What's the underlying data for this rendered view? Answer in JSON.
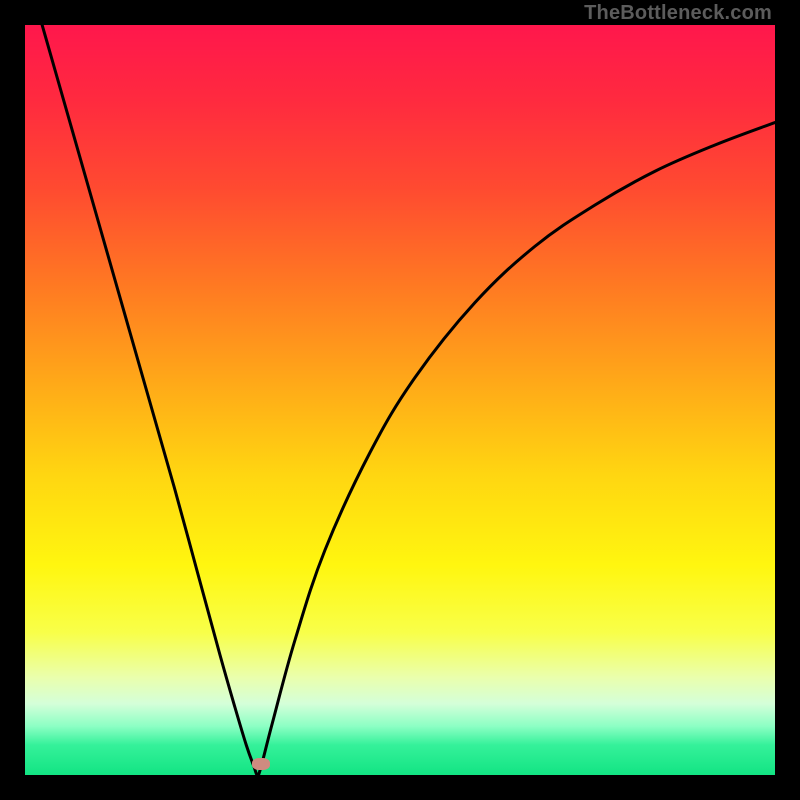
{
  "watermark": "TheBottleneck.com",
  "colors": {
    "plot_border": "#000000",
    "curve": "#000000",
    "marker": "#cf8b80",
    "gradient_stops": [
      {
        "offset": 0.0,
        "color": "#ff174c"
      },
      {
        "offset": 0.1,
        "color": "#ff2a3f"
      },
      {
        "offset": 0.22,
        "color": "#ff4b30"
      },
      {
        "offset": 0.35,
        "color": "#ff7a22"
      },
      {
        "offset": 0.48,
        "color": "#ffaa18"
      },
      {
        "offset": 0.6,
        "color": "#ffd611"
      },
      {
        "offset": 0.72,
        "color": "#fff60f"
      },
      {
        "offset": 0.81,
        "color": "#f8ff49"
      },
      {
        "offset": 0.87,
        "color": "#eaffad"
      },
      {
        "offset": 0.905,
        "color": "#d4ffd9"
      },
      {
        "offset": 0.935,
        "color": "#8cffc4"
      },
      {
        "offset": 0.96,
        "color": "#35f19a"
      },
      {
        "offset": 1.0,
        "color": "#12e483"
      }
    ]
  },
  "chart_data": {
    "type": "line",
    "title": "",
    "xlabel": "",
    "ylabel": "",
    "x_range": [
      0,
      100
    ],
    "y_range": [
      0,
      100
    ],
    "minimum_point": {
      "x": 31,
      "y": 0
    },
    "marker": {
      "x": 31.5,
      "y": 1.5
    },
    "series": [
      {
        "name": "curve",
        "x": [
          0,
          4,
          8,
          12,
          16,
          20,
          23,
          26,
          28,
          29.5,
          30.5,
          31,
          31.5,
          33,
          36,
          40,
          46,
          52,
          60,
          68,
          76,
          84,
          92,
          100
        ],
        "y": [
          108,
          94,
          80,
          66,
          52,
          38,
          27,
          16,
          9,
          4,
          1.2,
          0,
          1.2,
          7,
          18,
          30,
          43,
          53,
          63,
          70.5,
          76,
          80.5,
          84,
          87
        ]
      }
    ]
  }
}
